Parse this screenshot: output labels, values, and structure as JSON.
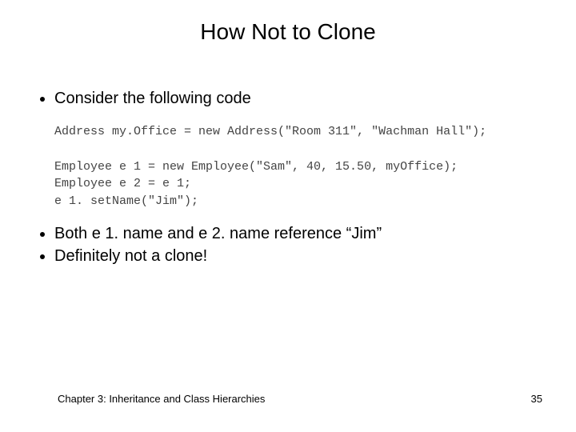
{
  "title": "How Not to Clone",
  "top_bullets": [
    "Consider the following code"
  ],
  "code_lines": [
    "Address my.Office = new Address(\"Room 311\", \"Wachman Hall\");",
    "",
    "Employee e 1 = new Employee(\"Sam\", 40, 15.50, myOffice);",
    "Employee e 2 = e 1;",
    "e 1. setName(\"Jim\");"
  ],
  "bottom_bullets": [
    "Both e 1. name and e 2. name reference “Jim”",
    "Definitely not a clone!"
  ],
  "footer": {
    "chapter": "Chapter 3: Inheritance and Class Hierarchies",
    "page": "35"
  }
}
